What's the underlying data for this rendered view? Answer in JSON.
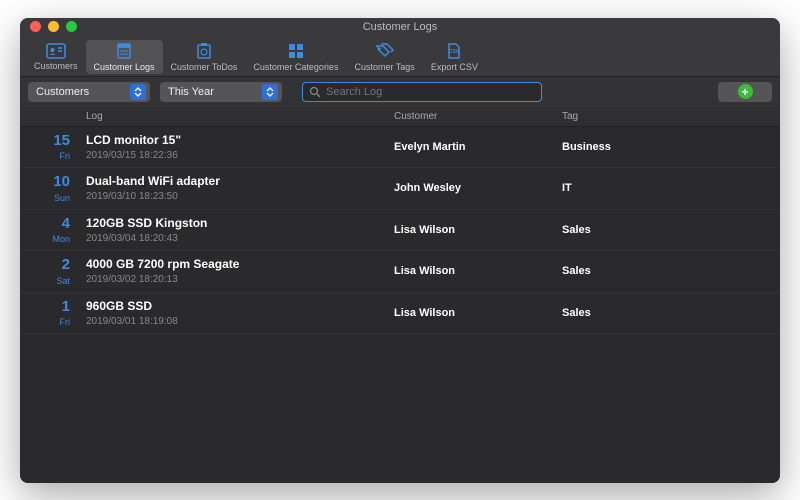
{
  "window": {
    "title": "Customer Logs"
  },
  "toolbar": {
    "items": [
      {
        "label": "Customers",
        "active": false
      },
      {
        "label": "Customer Logs",
        "active": true
      },
      {
        "label": "Customer ToDos",
        "active": false
      },
      {
        "label": "Customer Categories",
        "active": false
      },
      {
        "label": "Customer Tags",
        "active": false
      },
      {
        "label": "Export CSV",
        "active": false
      }
    ]
  },
  "filters": {
    "select1": "Customers",
    "select2": "This Year",
    "search_placeholder": "Search Log"
  },
  "columns": {
    "date": "",
    "log": "Log",
    "customer": "Customer",
    "tag": "Tag"
  },
  "rows": [
    {
      "daynum": "15",
      "dayname": "Fri",
      "title": "LCD monitor 15\"",
      "timestamp": "2019/03/15 18:22:36",
      "customer": "Evelyn Martin",
      "tag": "Business"
    },
    {
      "daynum": "10",
      "dayname": "Sun",
      "title": "Dual-band WiFi adapter",
      "timestamp": "2019/03/10 18:23:50",
      "customer": "John Wesley",
      "tag": "IT"
    },
    {
      "daynum": "4",
      "dayname": "Mon",
      "title": "120GB SSD Kingston",
      "timestamp": "2019/03/04 18:20:43",
      "customer": "Lisa Wilson",
      "tag": "Sales"
    },
    {
      "daynum": "2",
      "dayname": "Sat",
      "title": "4000 GB 7200 rpm Seagate",
      "timestamp": "2019/03/02 18:20:13",
      "customer": "Lisa Wilson",
      "tag": "Sales"
    },
    {
      "daynum": "1",
      "dayname": "Fri",
      "title": "960GB SSD",
      "timestamp": "2019/03/01 18:19:08",
      "customer": "Lisa Wilson",
      "tag": "Sales"
    }
  ]
}
